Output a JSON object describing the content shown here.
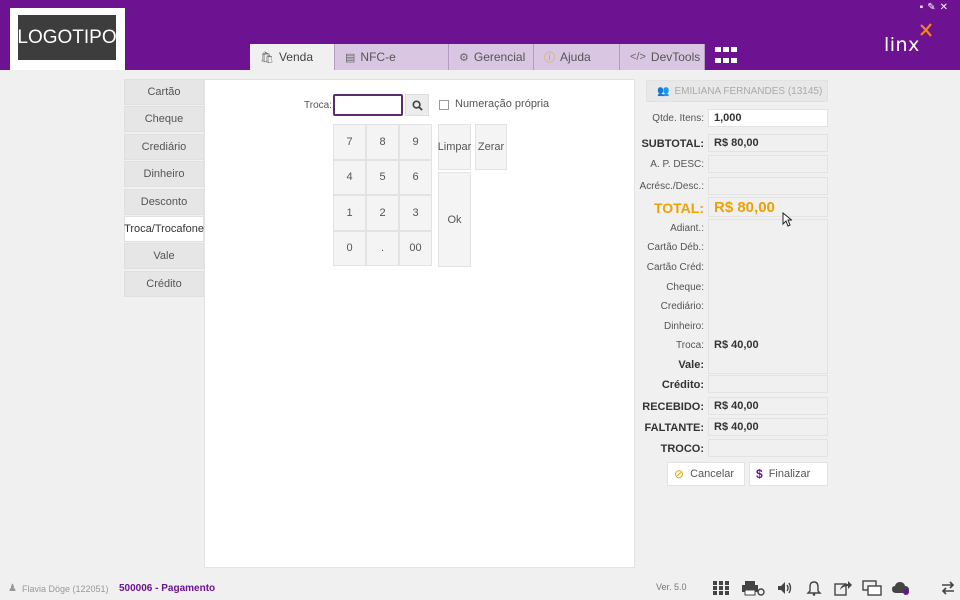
{
  "header": {
    "logo": "LOGOTIPO",
    "brand": "linx",
    "window_controls": [
      "▪",
      "✎",
      "✕"
    ],
    "tabs": [
      {
        "label": "Venda",
        "icon": "bag-icon",
        "active": true
      },
      {
        "label": "NFC-e",
        "icon": "receipt-icon",
        "active": false
      },
      {
        "label": "Gerencial",
        "icon": "gears-icon",
        "active": false
      },
      {
        "label": "Ajuda",
        "icon": "help-icon",
        "active": false
      },
      {
        "label": "DevTools",
        "icon": "code-icon",
        "active": false
      }
    ]
  },
  "menu": {
    "items": [
      "Cartão",
      "Cheque",
      "Crediário",
      "Dinheiro",
      "Desconto",
      "Troca/Trocafone",
      "Vale",
      "Crédito"
    ],
    "active": "Troca/Trocafone"
  },
  "center": {
    "troca_label": "Troca:",
    "troca_value": "",
    "numeracao_label": "Numeração própria",
    "keys": [
      "7",
      "8",
      "9",
      "4",
      "5",
      "6",
      "1",
      "2",
      "3",
      "0",
      ".",
      "00"
    ],
    "limpar": "Limpar",
    "zerar": "Zerar",
    "ok": "Ok"
  },
  "summary": {
    "customer": "EMILIANA FERNANDES (13145)",
    "qtde_label": "Qtde. Itens:",
    "qtde_value": "1,000",
    "subtotal_label": "SUBTOTAL:",
    "subtotal_value": "R$ 80,00",
    "apdesc_label": "A. P. DESC:",
    "acresc_label": "Acrésc./Desc.:",
    "total_label": "TOTAL:",
    "total_value": "R$ 80,00",
    "adiant_label": "Adiant.:",
    "cartao_deb_label": "Cartão Déb.:",
    "cartao_cred_label": "Cartão Créd:",
    "cheque_label": "Cheque:",
    "crediario_label": "Crediário:",
    "dinheiro_label": "Dinheiro:",
    "troca_label": "Troca:",
    "troca_value": "R$ 40,00",
    "vale_label": "Vale:",
    "credito_label": "Crédito:",
    "recebido_label": "RECEBIDO:",
    "recebido_value": "R$ 40,00",
    "faltante_label": "FALTANTE:",
    "faltante_value": "R$ 40,00",
    "troco_label": "TROCO:",
    "cancel_label": "Cancelar",
    "finalize_label": "Finalizar"
  },
  "status": {
    "user": "Flavia Döge (122051)",
    "message": "500006 - Pagamento",
    "version": "Ver. 5.0"
  },
  "colors": {
    "header": "#6d1290",
    "total": "#f0a000",
    "accent": "#5a2c6e"
  }
}
